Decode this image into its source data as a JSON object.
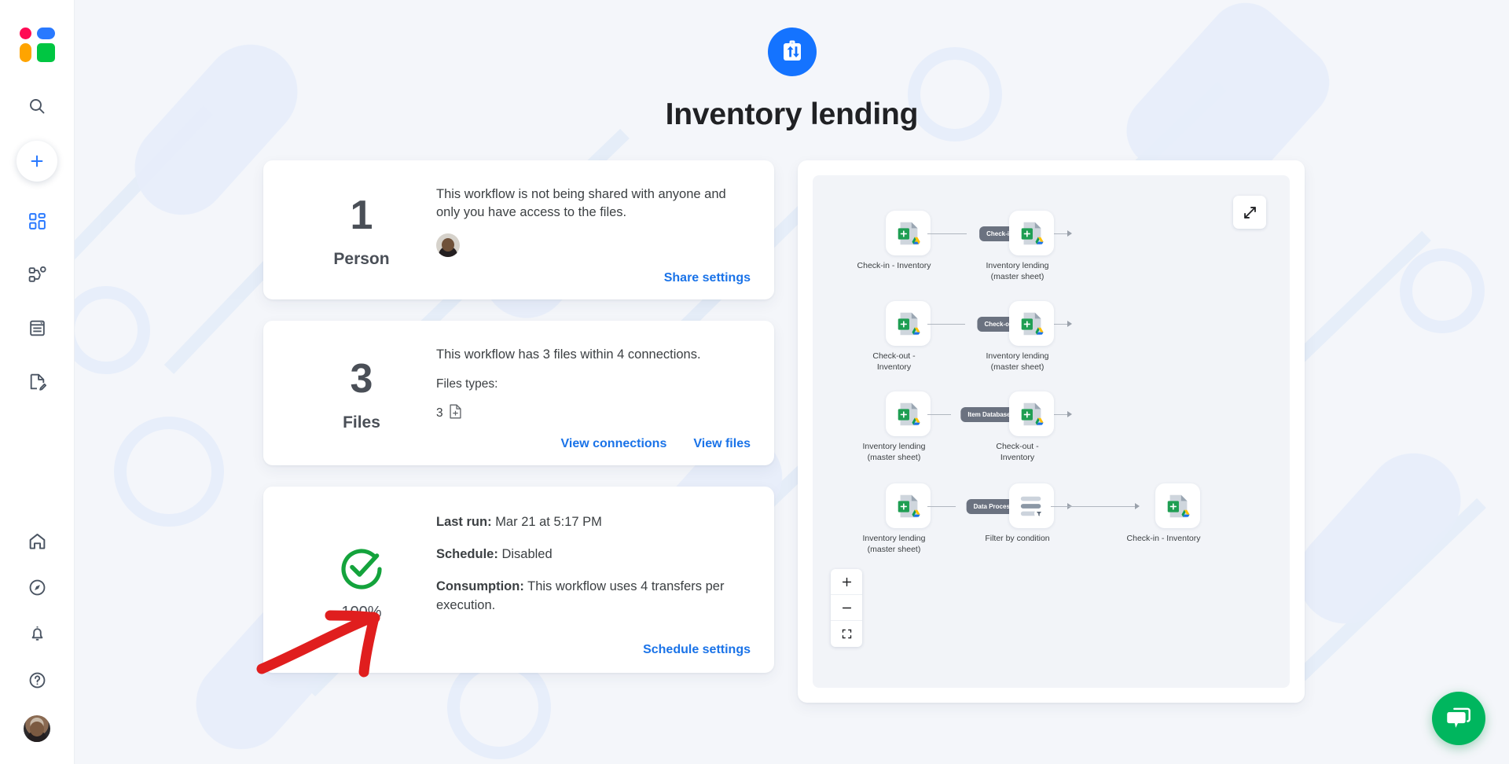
{
  "app": {
    "logo": "kanban-logo",
    "rail_icons": [
      {
        "name": "search-icon",
        "label": "Search"
      },
      {
        "name": "plus-icon",
        "label": "Create"
      },
      {
        "name": "dashboard-icon",
        "label": "Dashboard"
      },
      {
        "name": "workflow-icon",
        "label": "Workflows"
      },
      {
        "name": "sheet-icon",
        "label": "Sheets"
      },
      {
        "name": "form-icon",
        "label": "Forms"
      },
      {
        "name": "home-icon",
        "label": "Home"
      },
      {
        "name": "compass-icon",
        "label": "Explore"
      },
      {
        "name": "bell-icon",
        "label": "Notifications"
      },
      {
        "name": "help-icon",
        "label": "Help"
      }
    ]
  },
  "header": {
    "title": "Inventory lending",
    "badge_icon": "transfer-clipboard-icon",
    "badge_color": "#1473ff"
  },
  "cards": {
    "people": {
      "number": "1",
      "label": "Person",
      "description": "This workflow is not being shared with anyone and only you have access to the files.",
      "link": "Share settings"
    },
    "files": {
      "number": "3",
      "label": "Files",
      "description": "This workflow has 3 files within 4 connections.",
      "types_label": "Files types:",
      "type_count": "3",
      "type_icon": "sheet-file-icon",
      "link_connections": "View connections",
      "link_files": "View files"
    },
    "status": {
      "percent": "100%",
      "status_icon": "success-check-icon",
      "status_color": "#14a33c",
      "last_run_label": "Last run:",
      "last_run_value": "Mar 21 at 5:17 PM",
      "schedule_label": "Schedule:",
      "schedule_value": "Disabled",
      "consumption_label": "Consumption:",
      "consumption_value": "This workflow uses 4 transfers per execution.",
      "link": "Schedule settings"
    }
  },
  "diagram": {
    "expand_icon": "expand-diagonal-icon",
    "zoom_in": "+",
    "zoom_out": "−",
    "fit_icon": "fit-screen-icon",
    "rows": [
      {
        "source": "Check-in - Inventory",
        "connection": "Check-in",
        "target": "Inventory lending (master sheet)"
      },
      {
        "source": "Check-out - Inventory",
        "connection": "Check-out",
        "target": "Inventory lending (master sheet)"
      },
      {
        "source": "Inventory lending (master sheet)",
        "connection": "Item Database (Input)",
        "target": "Check-out - Inventory"
      },
      {
        "source": "Inventory lending (master sheet)",
        "connection": "Data Processing",
        "middle": "Filter by condition",
        "target": "Check-in - Inventory"
      }
    ],
    "node_labels": {
      "r1s": "Check-in - Inventory",
      "r1t_1": "Inventory lending",
      "r1t_2": "(master sheet)",
      "r2s_1": "Check-out -",
      "r2s_2": "Inventory",
      "r2t_1": "Inventory lending",
      "r2t_2": "(master sheet)",
      "r3s_1": "Inventory lending",
      "r3s_2": "(master sheet)",
      "r3t_1": "Check-out -",
      "r3t_2": "Inventory",
      "r4s_1": "Inventory lending",
      "r4s_2": "(master sheet)",
      "r4m": "Filter by condition",
      "r4t": "Check-in - Inventory"
    },
    "edge_labels": {
      "e1": "Check-in",
      "e2": "Check-out",
      "e3": "Item Database (Input)",
      "e4": "Data Processing"
    }
  },
  "chat": {
    "icon": "chat-bubbles-icon",
    "color": "#00b65e"
  },
  "annotation": {
    "color": "#e01e1e",
    "shape": "hand-drawn-arrow"
  }
}
